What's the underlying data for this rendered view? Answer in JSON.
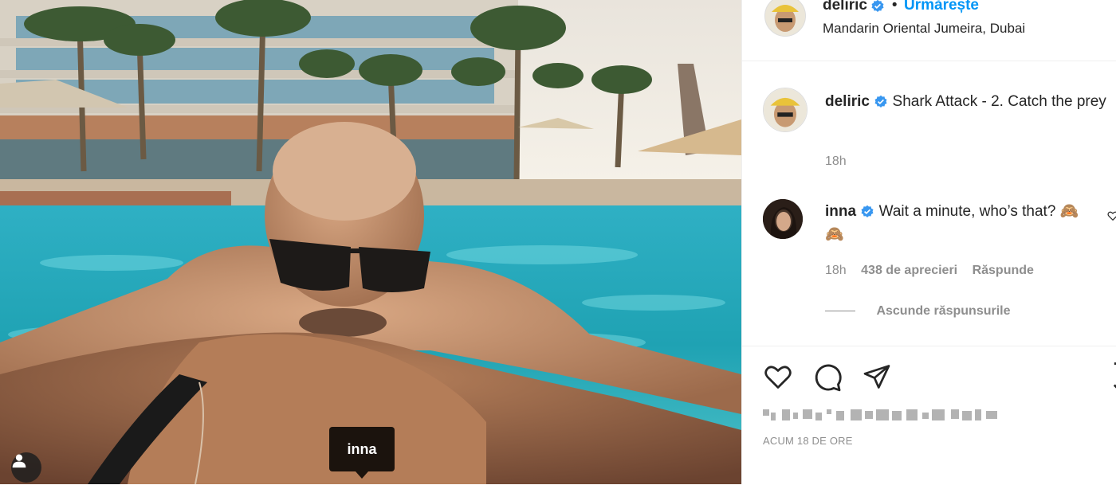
{
  "post": {
    "author": "deliric",
    "follow_label": "Urmărește",
    "location": "Mandarin Oriental Jumeira, Dubai",
    "caption_user": "deliric",
    "caption_text": "Shark Attack - 2. Catch the prey",
    "caption_time": "18h",
    "tag_label": "inna",
    "time_ago": "ACUM 18 DE ORE"
  },
  "comments": [
    {
      "user": "inna",
      "text": "Wait a minute, who’s that? 🙈🙈",
      "time": "18h",
      "likes": "438 de aprecieri",
      "reply_label": "Răspunde"
    }
  ],
  "replies_toggle": "Ascunde răspunsurile",
  "icons": {
    "like": "heart-icon",
    "comment": "comment-icon",
    "share": "share-icon",
    "save": "bookmark-icon",
    "verified": "verified-badge-icon",
    "user_tag": "user-tag-icon",
    "comment_like": "comment-heart-icon"
  },
  "colors": {
    "link": "#0095f6",
    "verified": "#3897f0",
    "text": "#262626",
    "muted": "#8e8e8e"
  }
}
